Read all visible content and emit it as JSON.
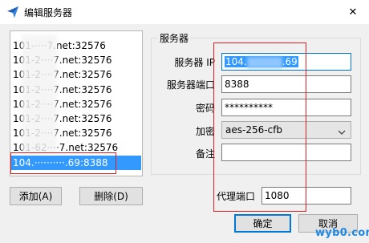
{
  "window": {
    "title": "编辑服务器",
    "icon": "paper-plane-icon",
    "close_label": "✕"
  },
  "server_list": {
    "items": [
      {
        "label": "101-····7.net:32576",
        "selected": false
      },
      {
        "label": "101-2····7.net:32576",
        "selected": false
      },
      {
        "label": "101-2····7.net:32576",
        "selected": false
      },
      {
        "label": "101-2····7.net:32576",
        "selected": false
      },
      {
        "label": "101-2····7.net:32576",
        "selected": false
      },
      {
        "label": "101-2····7.net:32576",
        "selected": false
      },
      {
        "label": "101-2····7.net:32576",
        "selected": false
      },
      {
        "label": "101-62····7.net:32576",
        "selected": false
      },
      {
        "label": "104.··········.69:8388",
        "selected": true
      }
    ]
  },
  "buttons": {
    "add_label": "添加(A)",
    "delete_label": "删除(D)",
    "ok_label": "确定",
    "cancel_label": "取消"
  },
  "server_group": {
    "legend": "服务器",
    "ip_label": "服务器 IP",
    "ip_value_prefix": "104.",
    "ip_value_suffix": ".69",
    "port_label": "服务器端口",
    "port_value": "8388",
    "password_label": "密码",
    "password_value": "**********",
    "encryption_label": "加密",
    "encryption_value": "aes-256-cfb",
    "remarks_label": "备注",
    "remarks_value": ""
  },
  "proxy": {
    "port_label": "代理端口",
    "port_value": "1080"
  },
  "watermark": "wyb0.com",
  "colors": {
    "selection": "#3399ff",
    "focus_border": "#0078d7",
    "highlight_box": "#e02020",
    "watermark": "#1e88e5"
  }
}
